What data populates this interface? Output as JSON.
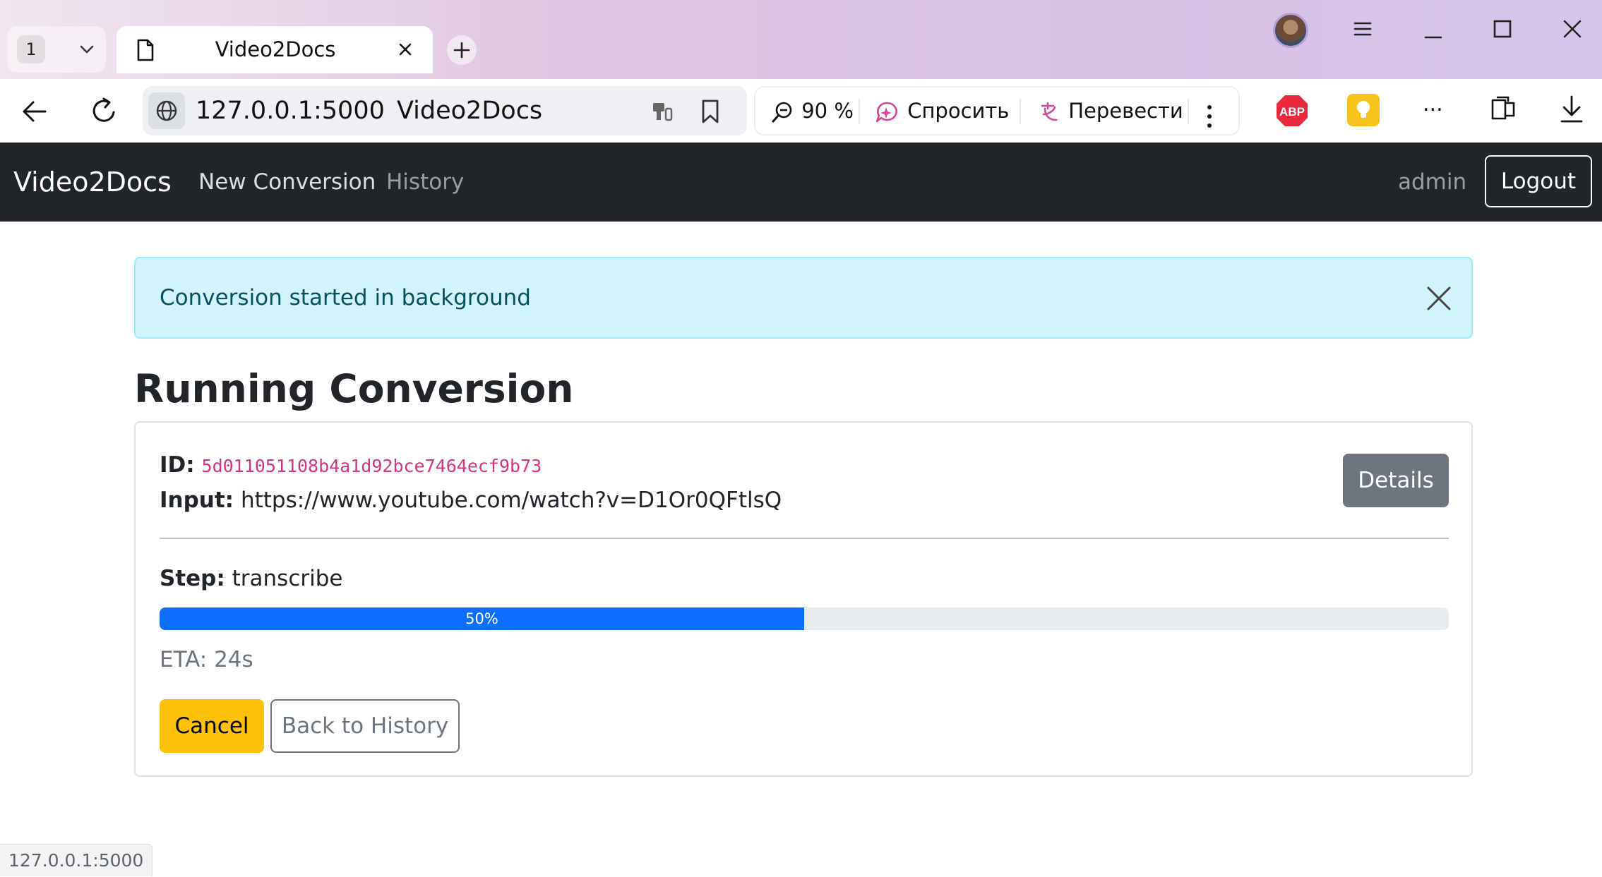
{
  "browser": {
    "tab_count": "1",
    "tab_title": "Video2Docs",
    "address_host": "127.0.0.1:5000",
    "address_page_title": "Video2Docs",
    "zoom": "90 %",
    "ask_label": "Спросить",
    "translate_label": "Перевести",
    "more_label": "...",
    "abp_label": "ABP",
    "status_url": "127.0.0.1:5000"
  },
  "navbar": {
    "brand": "Video2Docs",
    "links": [
      {
        "label": "New Conversion",
        "active": true
      },
      {
        "label": "History",
        "active": false
      }
    ],
    "user": "admin",
    "logout_label": "Logout"
  },
  "alert": {
    "message": "Conversion started in background"
  },
  "page": {
    "heading": "Running Conversion"
  },
  "conversion": {
    "id_label": "ID:",
    "id_value": "5d011051108b4a1d92bce7464ecf9b73",
    "input_label": "Input:",
    "input_value": "https://www.youtube.com/watch?v=D1Or0QFtlsQ",
    "details_label": "Details",
    "step_label": "Step:",
    "step_value": "transcribe",
    "progress_percent": 50,
    "progress_label": "50%",
    "eta": "ETA: 24s",
    "cancel_label": "Cancel",
    "back_label": "Back to History"
  },
  "colors": {
    "navbar_bg": "#212529",
    "alert_bg": "#cff4fc",
    "alert_text": "#055160",
    "progress_fill": "#0d6efd",
    "cancel_bg": "#ffc107",
    "details_bg": "#6c757d",
    "code_text": "#d63384"
  },
  "icons": {
    "tabs_dropdown": "chevron-down-icon",
    "tab_page": "document-icon",
    "tab_close": "close-icon",
    "new_tab": "plus-icon",
    "back": "arrow-left-icon",
    "reload": "reload-icon",
    "site_info": "globe-icon",
    "password": "key-icon",
    "bookmark": "bookmark-icon",
    "zoom": "zoom-out-icon",
    "ask": "ai-chat-icon",
    "translate": "translate-icon",
    "menu": "vertical-dots-icon",
    "downloads": "download-icon"
  }
}
